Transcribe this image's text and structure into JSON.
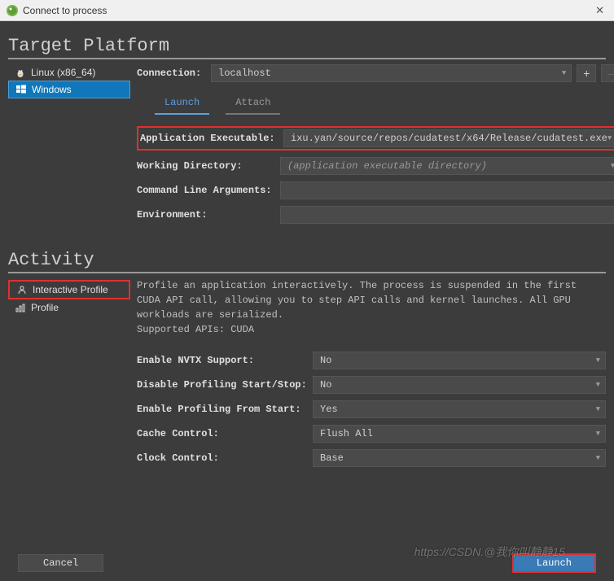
{
  "window": {
    "title": "Connect to process",
    "close": "✕"
  },
  "sections": {
    "target_platform": "Target Platform",
    "activity": "Activity"
  },
  "platforms": [
    {
      "id": "linux",
      "label": "Linux (x86_64)",
      "selected": false,
      "icon": "linux"
    },
    {
      "id": "windows",
      "label": "Windows",
      "selected": true,
      "icon": "windows"
    }
  ],
  "connection": {
    "label": "Connection:",
    "value": "localhost",
    "add": "+",
    "remove": "–",
    "edit": "✎"
  },
  "tabs": [
    {
      "id": "launch",
      "label": "Launch",
      "active": true
    },
    {
      "id": "attach",
      "label": "Attach",
      "active": false
    }
  ],
  "launch": {
    "exe_label": "Application Executable:",
    "exe_value": "ixu.yan/source/repos/cudatest/x64/Release/cudatest.exe",
    "browse": "...",
    "workdir_label": "Working Directory:",
    "workdir_placeholder": "(application executable directory)",
    "args_label": "Command Line Arguments:",
    "env_label": "Environment:"
  },
  "activities": [
    {
      "id": "interactive",
      "label": "Interactive Profile",
      "selected": true
    },
    {
      "id": "profile",
      "label": "Profile",
      "selected": false
    }
  ],
  "activity_desc": {
    "line1": "Profile an application interactively. The process is suspended in the first CUDA API call, allowing you to step API calls and kernel launches. All GPU workloads are serialized.",
    "line2": "Supported APIs: CUDA"
  },
  "options": [
    {
      "label": "Enable NVTX Support:",
      "value": "No"
    },
    {
      "label": "Disable Profiling Start/Stop:",
      "value": "No"
    },
    {
      "label": "Enable Profiling From Start:",
      "value": "Yes"
    },
    {
      "label": "Cache Control:",
      "value": "Flush All"
    },
    {
      "label": "Clock Control:",
      "value": "Base"
    }
  ],
  "buttons": {
    "cancel": "Cancel",
    "launch": "Launch"
  },
  "watermark": "https://CSDN.@我你叫静静15"
}
